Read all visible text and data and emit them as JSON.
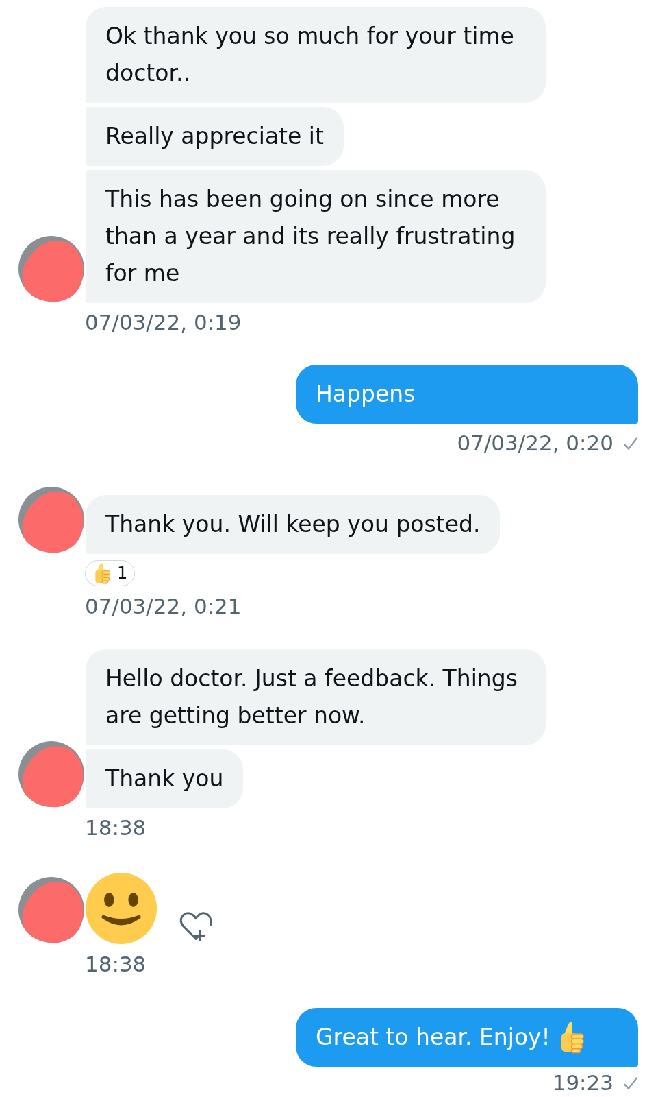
{
  "conversation": [
    {
      "kind": "received",
      "messages": [
        {
          "kind": "text",
          "text": "Ok thank you so much for your time doctor.."
        },
        {
          "kind": "text",
          "text": "Really appreciate it"
        },
        {
          "kind": "text",
          "text": "This has been going on since more than a year and its really frustrating for me"
        }
      ],
      "timestamp": "07/03/22, 0:19"
    },
    {
      "kind": "sent",
      "messages": [
        {
          "kind": "text",
          "text": "Happens"
        }
      ],
      "timestamp": "07/03/22, 0:20",
      "seen": true
    },
    {
      "kind": "received",
      "messages": [
        {
          "kind": "text",
          "text": "Thank you. Will keep you posted."
        }
      ],
      "reactions": [
        {
          "kind": "thumbs-up",
          "count": "1"
        }
      ],
      "timestamp": "07/03/22, 0:21"
    },
    {
      "kind": "received",
      "messages": [
        {
          "kind": "text",
          "text": "Hello doctor. Just a feedback. Things are getting better now."
        },
        {
          "kind": "text",
          "text": "Thank you"
        }
      ],
      "timestamp": "18:38"
    },
    {
      "kind": "received",
      "messages": [
        {
          "kind": "smiley"
        }
      ],
      "react_button": true,
      "timestamp": "18:38"
    },
    {
      "kind": "sent",
      "messages": [
        {
          "kind": "text-thumbs-up",
          "text": "Great to hear. Enjoy!"
        }
      ],
      "timestamp": "19:23",
      "seen": true
    }
  ]
}
